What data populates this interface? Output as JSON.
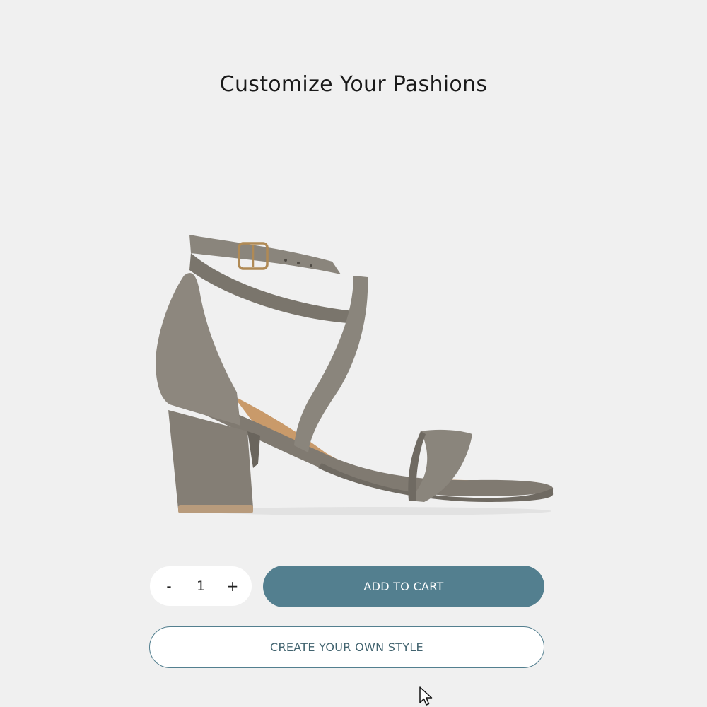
{
  "header": {
    "title": "Customize Your Pashions"
  },
  "product": {
    "image_icon": "heeled-sandal-image",
    "colors": {
      "strap": "#8a857c",
      "strap_shadow": "#6f6a62",
      "footbed": "#c99a6a",
      "buckle": "#b08a55"
    }
  },
  "quantity": {
    "minus_label": "-",
    "value": "1",
    "plus_label": "+"
  },
  "actions": {
    "add_to_cart_label": "ADD TO CART",
    "create_style_label": "CREATE YOUR OWN STYLE"
  },
  "colors": {
    "background": "#f0f0f0",
    "accent": "#537f8f",
    "outline_text": "#41636f"
  }
}
